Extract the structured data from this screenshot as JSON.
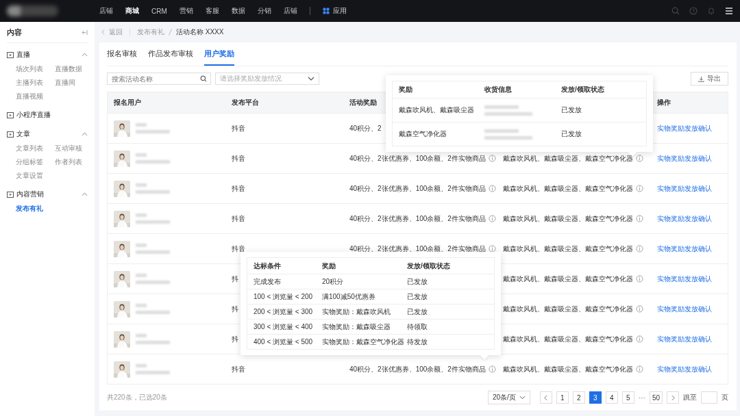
{
  "top_nav": {
    "items": [
      {
        "label": "店铺",
        "selected": false
      },
      {
        "label": "商城",
        "selected": true
      },
      {
        "label": "CRM",
        "selected": false
      },
      {
        "label": "营销",
        "selected": false
      },
      {
        "label": "客服",
        "selected": false
      },
      {
        "label": "数据",
        "selected": false
      },
      {
        "label": "分销",
        "selected": false
      },
      {
        "label": "店铺",
        "selected": false
      }
    ],
    "apps": "应用"
  },
  "sidebar": {
    "title": "内容",
    "groups": [
      {
        "kind": "section",
        "label": "直播",
        "expanded": true,
        "children": [
          {
            "label": "场次列表",
            "selected": false
          },
          {
            "label": "直播数据",
            "selected": false
          },
          {
            "label": "主播列表",
            "selected": false
          },
          {
            "label": "直播间",
            "selected": false
          },
          {
            "label": "直播视频",
            "selected": false
          }
        ]
      },
      {
        "kind": "link",
        "label": "小程序直播"
      },
      {
        "kind": "section",
        "label": "文章",
        "expanded": true,
        "children": [
          {
            "label": "文章列表",
            "selected": false
          },
          {
            "label": "互动审核",
            "selected": false
          },
          {
            "label": "分组标签",
            "selected": false
          },
          {
            "label": "作者列表",
            "selected": false
          },
          {
            "label": "文章设置",
            "selected": false
          }
        ]
      },
      {
        "kind": "section",
        "label": "内容营销",
        "expanded": true,
        "children": [
          {
            "label": "发布有礼",
            "selected": true
          }
        ]
      }
    ]
  },
  "breadcrumb": {
    "back": "返回",
    "items": [
      "发布有礼",
      "活动名称 XXXX"
    ]
  },
  "tabs": [
    {
      "label": "报名审核",
      "selected": false
    },
    {
      "label": "作品发布审核",
      "selected": false
    },
    {
      "label": "用户奖励",
      "selected": true
    }
  ],
  "search": {
    "placeholder": "搜索活动名称"
  },
  "filter": {
    "placeholder": "请选择奖励发放情况"
  },
  "export_button": "导出",
  "table": {
    "columns": [
      "报名用户",
      "发布平台",
      "活动奖励",
      "操作"
    ],
    "rows": [
      {
        "platform": "抖音",
        "reward": "40积分、2",
        "action": "实物奖励发放确认"
      },
      {
        "platform": "抖音",
        "reward": "40积分、2张优惠券、100余额、2件实物商品",
        "column_4": "戴森吹风机、戴森吸尘器、戴森空气净化器",
        "action": "实物奖励发放确认"
      },
      {
        "platform": "抖音",
        "reward": "40积分、2张优惠券、100余额、2件实物商品",
        "column_4": "戴森吹风机、戴森吸尘器、戴森空气净化器",
        "action": "实物奖励发放确认"
      },
      {
        "platform": "抖音",
        "reward": "40积分、2张优惠券、100余额、2件实物商品",
        "column_4": "戴森吹风机、戴森吸尘器、戴森空气净化器",
        "action": "实物奖励发放确认"
      },
      {
        "platform": "抖音",
        "reward": "40积分、2张优惠券、100余额、2件实物商品",
        "column_4": "戴森吹风机、戴森吸尘器、戴森空气净化器",
        "action": "实物奖励发放确认"
      },
      {
        "platform": "抖",
        "column_4": "戴森吹风机、戴森吸尘器、戴森空气净化器",
        "action": "实物奖励发放确认"
      },
      {
        "platform": "抖",
        "column_4": "戴森吹风机、戴森吸尘器、戴森空气净化器",
        "action": "实物奖励发放确认"
      },
      {
        "platform": "抖",
        "column_4": "戴森吹风机、戴森吸尘器、戴森空气净化器",
        "action": "实物奖励发放确认"
      },
      {
        "platform": "抖音",
        "reward": "40积分、2张优惠券、100余额、2件实物商品",
        "column_4": "戴森吹风机、戴森吸尘器、戴森空气净化器",
        "action": "实物奖励发放确认"
      }
    ]
  },
  "reward_popover": {
    "columns": [
      "奖励",
      "收货信息",
      "发放/领取状态"
    ],
    "rows": [
      {
        "reward": "戴森吹风机、戴森吸尘器",
        "status": "已发放"
      },
      {
        "reward": "戴森空气净化器",
        "status": "已发放"
      }
    ]
  },
  "condition_popover": {
    "columns": [
      "达标条件",
      "奖励",
      "发放/领取状态"
    ],
    "rows": [
      {
        "condition": "完成发布",
        "reward": "20积分",
        "status": "已发放"
      },
      {
        "condition": "100 < 浏览量 < 200",
        "reward": "满100减50优惠券",
        "status": "已发放"
      },
      {
        "condition": "200 < 浏览量 < 300",
        "reward": "实物奖励：戴森吹风机",
        "status": "已发放"
      },
      {
        "condition": "300 < 浏览量 < 400",
        "reward": "实物奖励：戴森吸尘器",
        "status": "待领取"
      },
      {
        "condition": "400 < 浏览量 < 500",
        "reward": "实物奖励：戴森空气净化器",
        "status": "待发放"
      }
    ]
  },
  "footer": {
    "summary": "共220条，已选20条",
    "page_size": "20条/页",
    "pages": [
      {
        "kind": "page",
        "label": "1",
        "selected": false
      },
      {
        "kind": "page",
        "label": "2",
        "selected": false
      },
      {
        "kind": "page",
        "label": "3",
        "selected": true
      },
      {
        "kind": "page",
        "label": "4",
        "selected": false
      },
      {
        "kind": "page",
        "label": "5",
        "selected": false
      },
      {
        "kind": "ellipsis",
        "label": "···"
      },
      {
        "kind": "page",
        "label": "50",
        "selected": false
      }
    ],
    "jump_label": "跳至",
    "jump_suffix": "页"
  }
}
